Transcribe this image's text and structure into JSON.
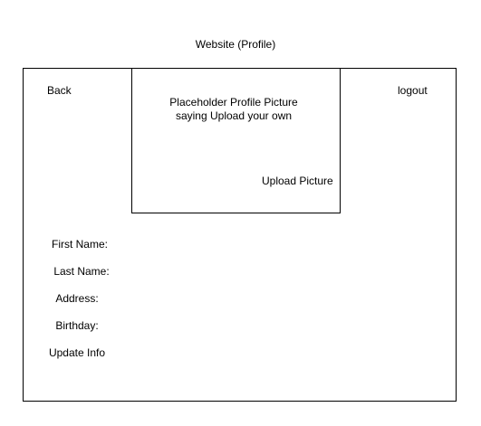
{
  "title": "Website (Profile)",
  "nav": {
    "back": "Back",
    "logout": "logout"
  },
  "profile_picture": {
    "placeholder_line1": "Placeholder Profile Picture",
    "placeholder_line2": "saying Upload your own",
    "upload_label": "Upload Picture"
  },
  "form": {
    "first_name": "First Name:",
    "last_name": "Last Name:",
    "address": "Address:",
    "birthday": "Birthday:",
    "update_label": "Update Info"
  }
}
